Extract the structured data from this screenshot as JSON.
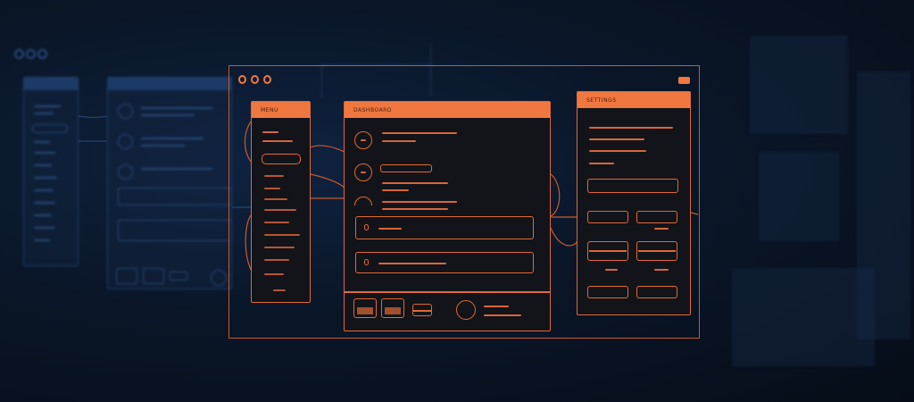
{
  "colors": {
    "accent": "#f07840",
    "wire": "#e06a34",
    "background": "#0a1628",
    "background_mockup": "#1c3a66"
  },
  "wireframe": {
    "nav_panel": {
      "header": "MENU"
    },
    "main_panel": {
      "header": "DASHBOARD"
    },
    "side_panel": {
      "header": "SETTINGS"
    }
  },
  "icons": [
    "window-dot-icon",
    "avatar-icon",
    "toggle-icon",
    "pin-icon",
    "cursor-arrow-icon"
  ]
}
